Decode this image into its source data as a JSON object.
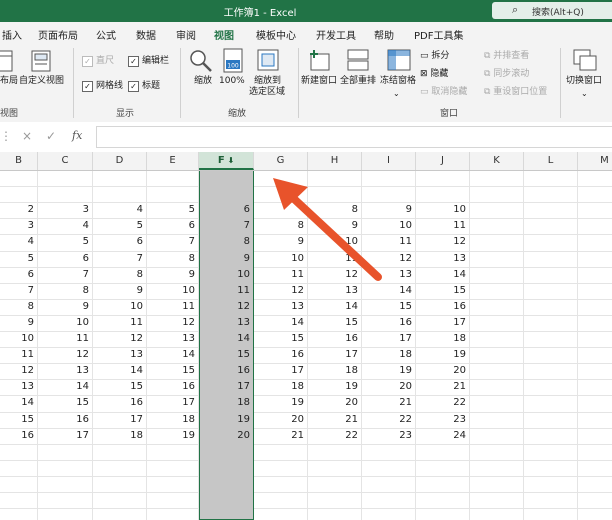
{
  "window": {
    "title": "工作簿1 - Excel",
    "search_placeholder": "搜索(Alt+Q)"
  },
  "tabs": [
    {
      "label": "插入",
      "active": false
    },
    {
      "label": "页面布局",
      "active": false
    },
    {
      "label": "公式",
      "active": false
    },
    {
      "label": "数据",
      "active": false
    },
    {
      "label": "审阅",
      "active": false
    },
    {
      "label": "视图",
      "active": true
    },
    {
      "label": "模板中心",
      "active": false
    },
    {
      "label": "开发工具",
      "active": false
    },
    {
      "label": "帮助",
      "active": false
    },
    {
      "label": "PDF工具集",
      "active": false
    }
  ],
  "ribbon": {
    "views": {
      "page_layout": "布局",
      "custom_view": "自定义视图",
      "group_label": "视图"
    },
    "show": {
      "ruler": "直尺",
      "formula_bar": "编辑栏",
      "gridlines": "网格线",
      "headings": "标题",
      "group_label": "显示",
      "ruler_checked": true,
      "formula_bar_checked": true,
      "gridlines_checked": true,
      "headings_checked": true
    },
    "zoom": {
      "zoom": "缩放",
      "zoom_line2": "放",
      "hundred": "100%",
      "to_selection_1": "缩放到",
      "to_selection_2": "选定区域",
      "group_label": "缩放"
    },
    "window": {
      "new_window": "新建窗口",
      "arrange_all": "全部重排",
      "freeze_panes": "冻结窗格",
      "split": "拆分",
      "hide": "隐藏",
      "unhide": "取消隐藏",
      "side_by_side": "并排查看",
      "sync_scroll": "同步滚动",
      "reset_position": "重设窗口位置",
      "switch_windows": "切换窗口",
      "group_label": "窗口"
    }
  },
  "formula_bar": {
    "cancel": "×",
    "enter": "✓",
    "fx": "fx",
    "value": ""
  },
  "sheet": {
    "columns": [
      "B",
      "C",
      "D",
      "E",
      "F",
      "G",
      "H",
      "I",
      "J",
      "K",
      "L",
      "M"
    ],
    "selected_column": "F",
    "rows": [
      [
        "",
        "",
        "",
        "",
        "",
        "",
        "",
        "",
        "",
        "",
        "",
        ""
      ],
      [
        "",
        "",
        "",
        "",
        "",
        "",
        "",
        "",
        "",
        "",
        "",
        ""
      ],
      [
        "2",
        "3",
        "4",
        "5",
        "6",
        "",
        "8",
        "9",
        "10",
        "",
        "",
        ""
      ],
      [
        "3",
        "4",
        "5",
        "6",
        "7",
        "8",
        "9",
        "10",
        "11",
        "",
        "",
        ""
      ],
      [
        "4",
        "5",
        "6",
        "7",
        "8",
        "9",
        "10",
        "11",
        "12",
        "",
        "",
        ""
      ],
      [
        "5",
        "6",
        "7",
        "8",
        "9",
        "10",
        "11",
        "12",
        "13",
        "",
        "",
        ""
      ],
      [
        "6",
        "7",
        "8",
        "9",
        "10",
        "11",
        "12",
        "13",
        "14",
        "",
        "",
        ""
      ],
      [
        "7",
        "8",
        "9",
        "10",
        "11",
        "12",
        "13",
        "14",
        "15",
        "",
        "",
        ""
      ],
      [
        "8",
        "9",
        "10",
        "11",
        "12",
        "13",
        "14",
        "15",
        "16",
        "",
        "",
        ""
      ],
      [
        "9",
        "10",
        "11",
        "12",
        "13",
        "14",
        "15",
        "16",
        "17",
        "",
        "",
        ""
      ],
      [
        "10",
        "11",
        "12",
        "13",
        "14",
        "15",
        "16",
        "17",
        "18",
        "",
        "",
        ""
      ],
      [
        "11",
        "12",
        "13",
        "14",
        "15",
        "16",
        "17",
        "18",
        "19",
        "",
        "",
        ""
      ],
      [
        "12",
        "13",
        "14",
        "15",
        "16",
        "17",
        "18",
        "19",
        "20",
        "",
        "",
        ""
      ],
      [
        "13",
        "14",
        "15",
        "16",
        "17",
        "18",
        "19",
        "20",
        "21",
        "",
        "",
        ""
      ],
      [
        "14",
        "15",
        "16",
        "17",
        "18",
        "19",
        "20",
        "21",
        "22",
        "",
        "",
        ""
      ],
      [
        "15",
        "16",
        "17",
        "18",
        "19",
        "20",
        "21",
        "22",
        "23",
        "",
        "",
        ""
      ],
      [
        "16",
        "17",
        "18",
        "19",
        "20",
        "21",
        "22",
        "23",
        "24",
        "",
        "",
        ""
      ]
    ]
  },
  "colors": {
    "accent": "#217346",
    "selection_fill": "#c6c6c6",
    "annotation_arrow": "#e8532b"
  }
}
